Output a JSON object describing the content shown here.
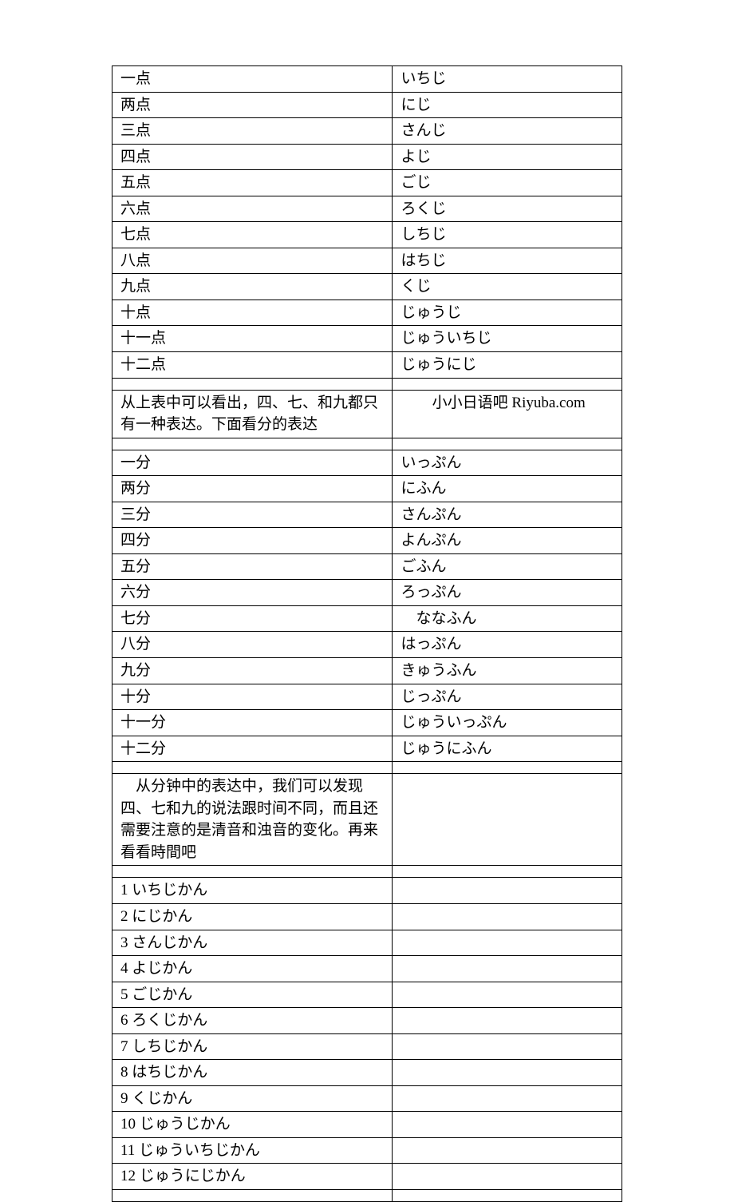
{
  "hours": [
    {
      "cn": "一点",
      "jp": "いちじ"
    },
    {
      "cn": "两点",
      "jp": "にじ"
    },
    {
      "cn": "三点",
      "jp": "さんじ"
    },
    {
      "cn": "四点",
      "jp": "よじ"
    },
    {
      "cn": "五点",
      "jp": "ごじ"
    },
    {
      "cn": "六点",
      "jp": "ろくじ"
    },
    {
      "cn": "七点",
      "jp": "しちじ"
    },
    {
      "cn": "八点",
      "jp": "はちじ"
    },
    {
      "cn": "九点",
      "jp": "くじ"
    },
    {
      "cn": "十点",
      "jp": "じゅうじ"
    },
    {
      "cn": "十一点",
      "jp": "じゅういちじ"
    },
    {
      "cn": "十二点",
      "jp": "じゅうにじ"
    }
  ],
  "note1_left": "从上表中可以看出，四、七、和九都只有一种表达。下面看分的表达",
  "note1_right": "小小日语吧 Riyuba.com",
  "minutes": [
    {
      "cn": "一分",
      "jp": "いっぷん"
    },
    {
      "cn": "两分",
      "jp": "にふん"
    },
    {
      "cn": "三分",
      "jp": "さんぷん"
    },
    {
      "cn": "四分",
      "jp": "よんぷん"
    },
    {
      "cn": "五分",
      "jp": "ごふん"
    },
    {
      "cn": "六分",
      "jp": "ろっぷん"
    },
    {
      "cn": "七分",
      "jp": "　ななふん"
    },
    {
      "cn": "八分",
      "jp": "はっぷん"
    },
    {
      "cn": "九分",
      "jp": "きゅうふん"
    },
    {
      "cn": "十分",
      "jp": "じっぷん"
    },
    {
      "cn": "十一分",
      "jp": "じゅういっぷん"
    },
    {
      "cn": "十二分",
      "jp": "じゅうにふん"
    }
  ],
  "note2": "　从分钟中的表达中，我们可以发现四、七和九的说法跟时间不同，而且还需要注意的是清音和浊音的变化。再来看看時間吧",
  "durations": [
    "1 いちじかん",
    "2 にじかん",
    "3 さんじかん",
    "4 よじかん",
    "5 ごじかん",
    "6 ろくじかん",
    "7 しちじかん",
    "8 はちじかん",
    "9 くじかん",
    "10 じゅうじかん",
    "11 じゅういちじかん",
    "12 じゅうにじかん"
  ]
}
